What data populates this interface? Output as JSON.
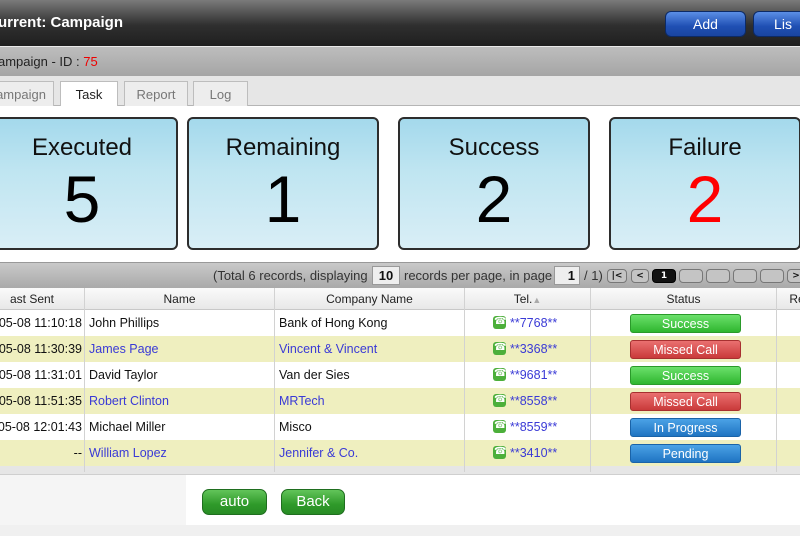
{
  "header": {
    "title": "urrent: Campaign",
    "add_label": "Add",
    "list_label": "Lis"
  },
  "subheader": {
    "label": "ampaign - ID : ",
    "id_value": "75"
  },
  "tabs": [
    {
      "label": "ampaign",
      "active": false
    },
    {
      "label": "Task",
      "active": true
    },
    {
      "label": "Report",
      "active": false
    },
    {
      "label": "Log",
      "active": false
    }
  ],
  "stats": {
    "executed": {
      "label": "Executed",
      "value": "5"
    },
    "remaining": {
      "label": "Remaining",
      "value": "1"
    },
    "success": {
      "label": "Success",
      "value": "2"
    },
    "failure": {
      "label": "Failure",
      "value": "2",
      "color": "#ff0000"
    }
  },
  "pager": {
    "text_before": "(Total 6 records, displaying",
    "per_page": "10",
    "text_mid": "records per page, in page",
    "current_page": "1",
    "text_after": "/ 1)",
    "first_label": "|<",
    "prev_label": "<",
    "page_label": "1",
    "next_label": ">"
  },
  "table": {
    "columns": [
      "ast Sent",
      "Name",
      "Company Name",
      "Tel.",
      "Status",
      "Re"
    ],
    "sort_indicator": "▲",
    "rows": [
      {
        "sent": "05-08 11:10:18",
        "name": "John Phillips",
        "company": "Bank of Hong Kong",
        "tel": "**7768**",
        "status": "Success",
        "status_type": "success",
        "highlight": false
      },
      {
        "sent": "05-08 11:30:39",
        "name": "James Page",
        "company": "Vincent & Vincent",
        "tel": "**3368**",
        "status": "Missed Call",
        "status_type": "missed",
        "highlight": true
      },
      {
        "sent": "05-08 11:31:01",
        "name": "David Taylor",
        "company": "Van der Sies",
        "tel": "**9681**",
        "status": "Success",
        "status_type": "success",
        "highlight": false
      },
      {
        "sent": "05-08 11:51:35",
        "name": "Robert Clinton",
        "company": "MRTech",
        "tel": "**8558**",
        "status": "Missed Call",
        "status_type": "missed",
        "highlight": true
      },
      {
        "sent": "05-08 12:01:43",
        "name": "Michael Miller",
        "company": "Misco",
        "tel": "**8559**",
        "status": "In Progress",
        "status_type": "progress",
        "highlight": false
      },
      {
        "sent": "--",
        "name": "William Lopez",
        "company": "Jennifer & Co.",
        "tel": "**3410**",
        "status": "Pending",
        "status_type": "pending",
        "highlight": true
      }
    ]
  },
  "footer": {
    "auto_label": "auto",
    "back_label": "Back"
  }
}
